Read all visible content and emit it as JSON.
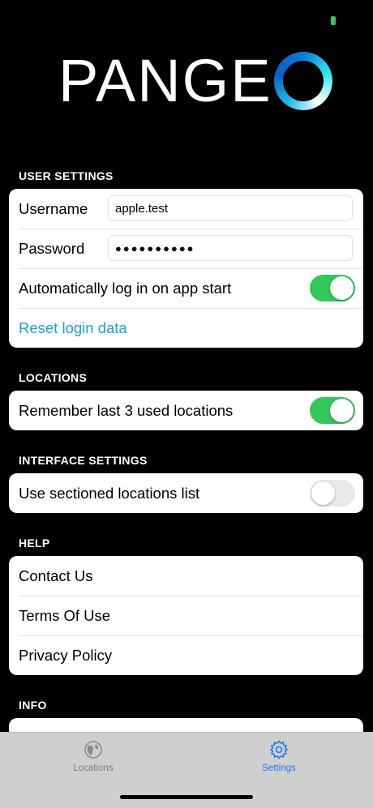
{
  "logo": {
    "text": "PANGE"
  },
  "sections": {
    "user_settings": {
      "header": "USER SETTINGS",
      "username_label": "Username",
      "username_value": "apple.test",
      "password_label": "Password",
      "password_value": "●●●●●●●●●●",
      "autologin_label": "Automatically log in on app start",
      "autologin_on": true,
      "reset_label": "Reset login data"
    },
    "locations": {
      "header": "LOCATIONS",
      "remember_label": "Remember last 3 used locations",
      "remember_on": true
    },
    "interface": {
      "header": "INTERFACE SETTINGS",
      "sectioned_label": "Use sectioned locations list",
      "sectioned_on": false
    },
    "help": {
      "header": "HELP",
      "items": [
        "Contact Us",
        "Terms Of Use",
        "Privacy Policy"
      ]
    },
    "info": {
      "header": "INFO"
    }
  },
  "tabbar": {
    "locations_label": "Locations",
    "settings_label": "Settings",
    "active": "Settings"
  },
  "colors": {
    "accent": "#1e7bf1",
    "toggle_on": "#34c759",
    "link": "#1aa3d6"
  }
}
